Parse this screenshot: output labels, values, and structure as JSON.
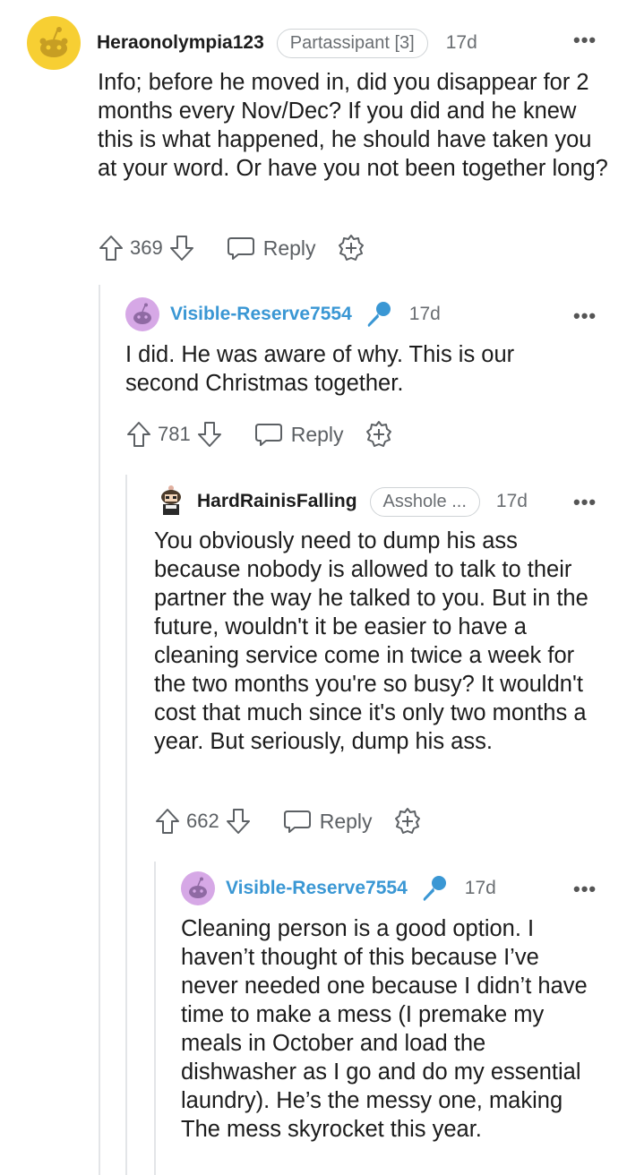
{
  "comments": [
    {
      "username": "Heraonolympia123",
      "flair": "Partassipant [3]",
      "time": "17d",
      "body": "Info; before he moved in, did you disappear for 2 months every Nov/Dec? If you did and he knew this is what happened, he should have taken you at your word. Or have you not been together long?",
      "score": "369",
      "reply_label": "Reply"
    },
    {
      "username": "Visible-Reserve7554",
      "time": "17d",
      "body": "I did. He was aware of why. This is our second Christmas together.",
      "score": "781",
      "reply_label": "Reply"
    },
    {
      "username": "HardRainisFalling",
      "flair": "Asshole ...",
      "time": "17d",
      "body": "You obviously need to dump his ass because nobody is allowed to talk to their partner the way he talked to you. But in the future, wouldn't it be easier to have a cleaning service come in twice a week for the two months you're so busy? It wouldn't cost that much since it's only two months a year. But seriously, dump his ass.",
      "score": "662",
      "reply_label": "Reply"
    },
    {
      "username": "Visible-Reserve7554",
      "time": "17d",
      "body": "Cleaning person is a good option. I haven’t thought of this because I’ve never needed one because I didn’t have time to make a mess (I premake my meals in October and load the dishwasher as I go and do my essential laundry). He’s the messy one, making The mess skyrocket this year."
    }
  ],
  "colors": {
    "op_username": "#3a97d4",
    "avatar_yellow": "#f7cf33",
    "avatar_purple": "#d6a8e6",
    "thread_line": "#e3e5e8"
  },
  "icons": [
    "snoo-avatar",
    "microphone-icon",
    "upvote-icon",
    "downvote-icon",
    "reply-icon",
    "award-icon",
    "more-options-icon"
  ]
}
